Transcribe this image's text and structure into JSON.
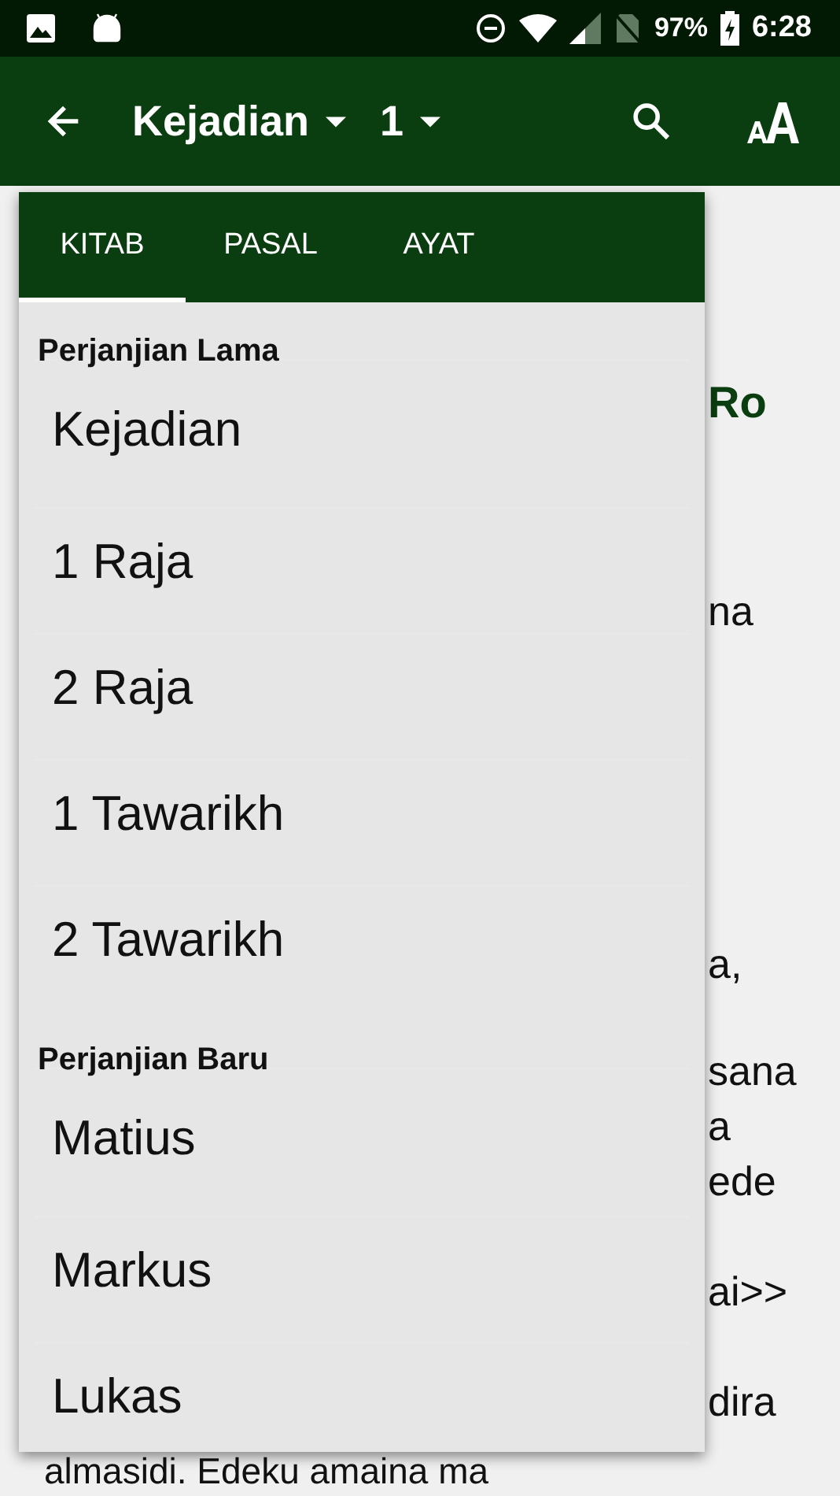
{
  "status_bar": {
    "battery": "97%",
    "time": "6:28"
  },
  "app_bar": {
    "book": "Kejadian",
    "chapter": "1"
  },
  "reader": {
    "heading": "Ro",
    "fragments": [
      "na",
      "a,",
      "sana",
      "a",
      "ede",
      "ai>>",
      "dira"
    ],
    "last_line": "almasidi. Edeku amaina ma"
  },
  "picker": {
    "tabs": [
      {
        "label": "KITAB",
        "selected": true
      },
      {
        "label": "PASAL",
        "selected": false
      },
      {
        "label": "AYAT",
        "selected": false
      }
    ],
    "items": [
      {
        "kind": "header",
        "label": "Perjanjian Lama"
      },
      {
        "kind": "book",
        "label": "Kejadian"
      },
      {
        "kind": "book",
        "label": "1 Raja"
      },
      {
        "kind": "book",
        "label": "2 Raja"
      },
      {
        "kind": "book",
        "label": "1 Tawarikh"
      },
      {
        "kind": "book",
        "label": "2 Tawarikh"
      },
      {
        "kind": "header",
        "label": "Perjanjian Baru"
      },
      {
        "kind": "book",
        "label": "Matius"
      },
      {
        "kind": "book",
        "label": "Markus"
      },
      {
        "kind": "book",
        "label": "Lukas"
      }
    ]
  }
}
